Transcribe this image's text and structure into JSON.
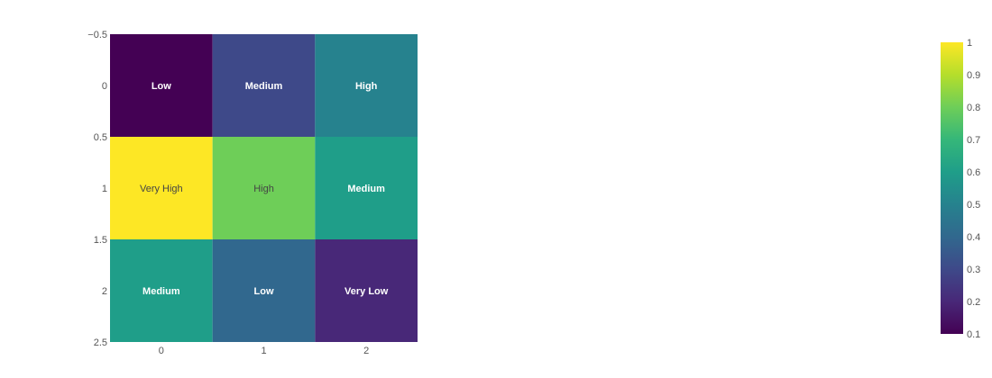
{
  "chart_data": {
    "type": "heatmap",
    "colorscale": "Viridis",
    "x": [
      0,
      1,
      2
    ],
    "y": [
      0,
      1,
      2
    ],
    "z": [
      [
        0.1,
        0.3,
        0.5
      ],
      [
        1.0,
        0.8,
        0.6
      ],
      [
        0.6,
        0.4,
        0.2
      ]
    ],
    "text": [
      [
        "Low",
        "Medium",
        "High"
      ],
      [
        "Very High",
        "High",
        "Medium"
      ],
      [
        "Medium",
        "Low",
        "Very Low"
      ]
    ],
    "xlim": [
      -0.5,
      2.5
    ],
    "ylim": [
      2.5,
      -0.5
    ],
    "x_tick_labels": [
      "0",
      "1",
      "2"
    ],
    "y_tick_labels": [
      "−0.5",
      "0",
      "0.5",
      "1",
      "1.5",
      "2",
      "2.5"
    ],
    "colorbar": {
      "range": [
        0.1,
        1
      ],
      "tick_labels": [
        "0.1",
        "0.2",
        "0.3",
        "0.4",
        "0.5",
        "0.6",
        "0.7",
        "0.8",
        "0.9",
        "1"
      ]
    },
    "grid": false
  }
}
